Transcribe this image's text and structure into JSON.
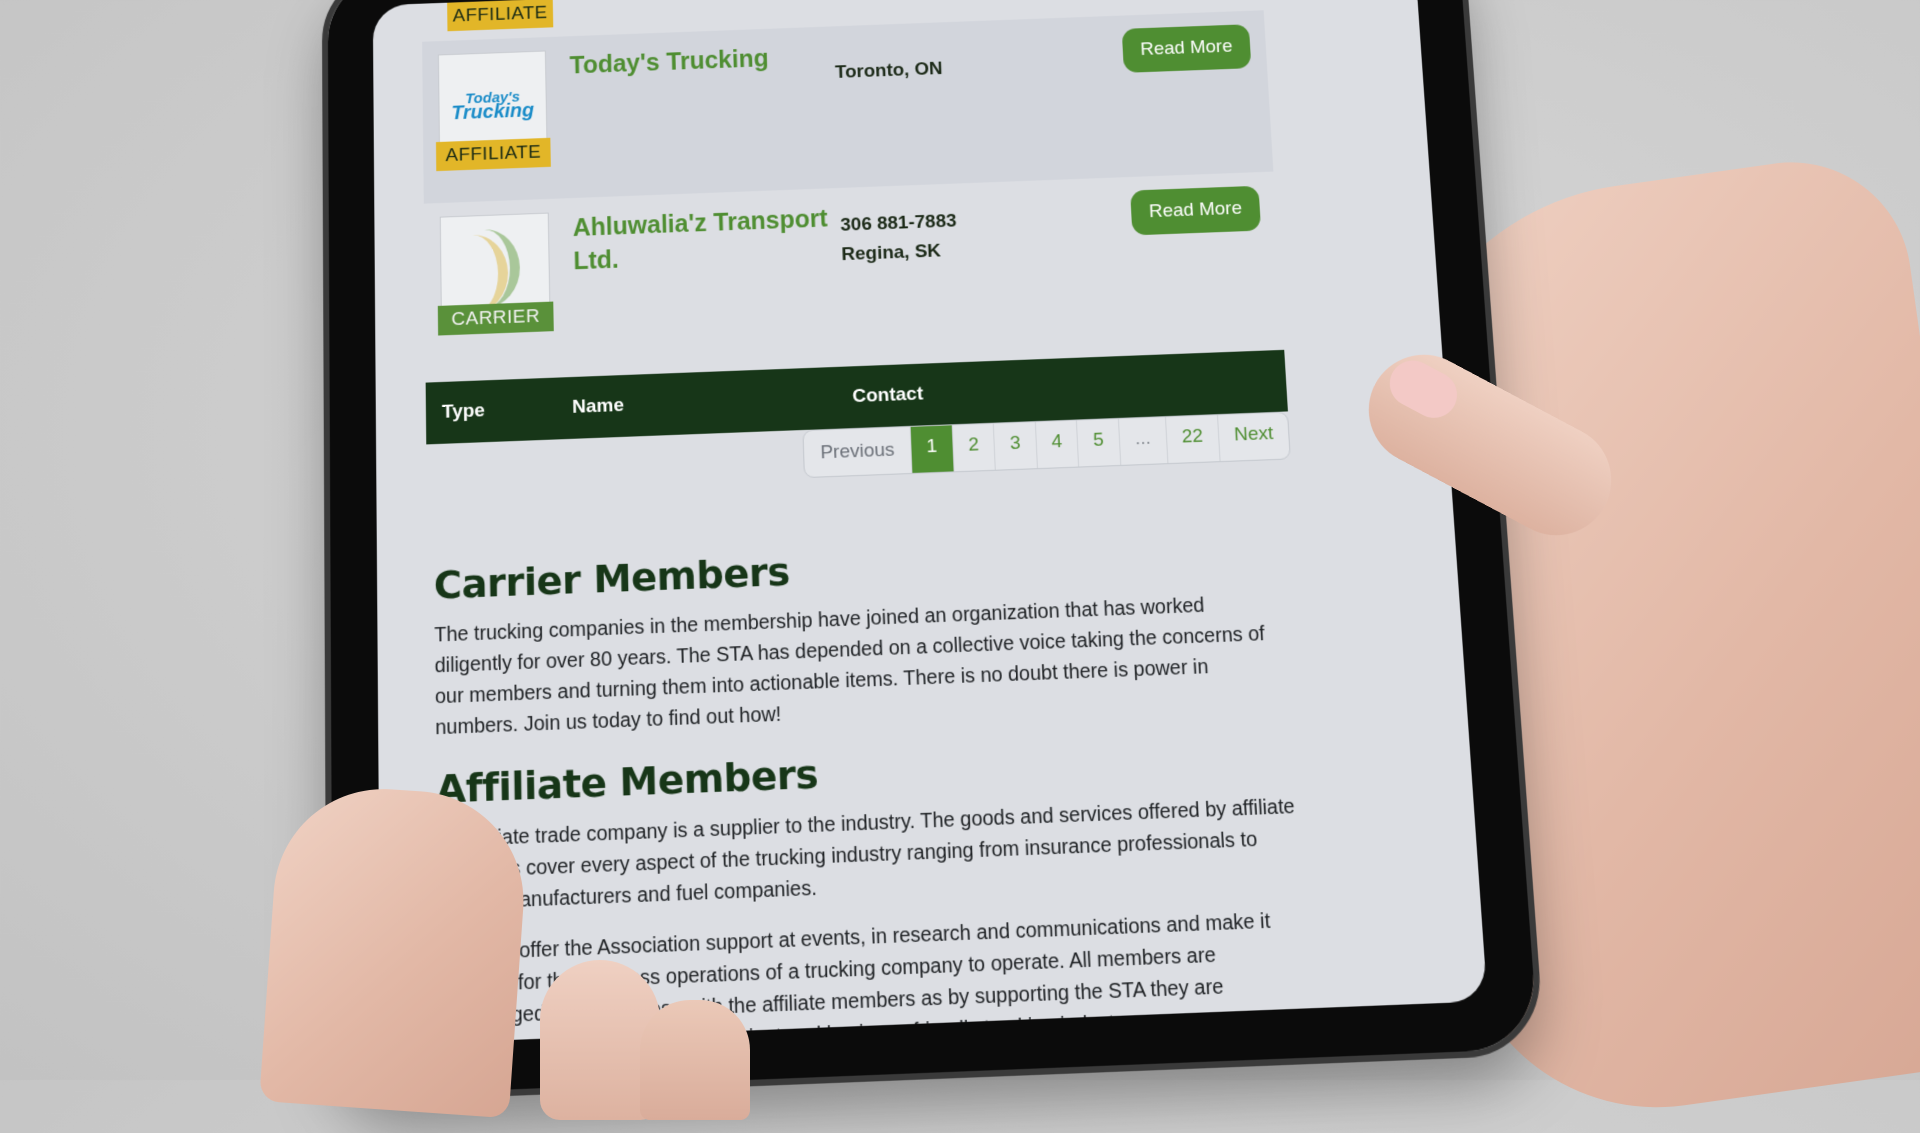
{
  "listings": [
    {
      "name": "Today's Trucking",
      "logo_text_top": "Today's",
      "logo_text_bottom": "Trucking",
      "type": "AFFILIATE",
      "phone": "",
      "location": "Toronto, ON",
      "button": "Read More"
    },
    {
      "name": "Ahluwalia'z Transport Ltd.",
      "type": "CARRIER",
      "phone": "306 881-7883",
      "location": "Regina, SK",
      "button": "Read More"
    }
  ],
  "previous_badge": "AFFILIATE",
  "table_header": {
    "type": "Type",
    "name": "Name",
    "contact": "Contact"
  },
  "pagination": {
    "previous": "Previous",
    "pages": [
      "1",
      "2",
      "3",
      "4",
      "5",
      "...",
      "22"
    ],
    "current": "1",
    "next": "Next"
  },
  "sections": {
    "carrier": {
      "title": "Carrier Members",
      "body": "The trucking companies in the membership have joined an organization that has worked diligently for over 80 years. The STA has depended on a collective voice taking the concerns of our members and turning them into actionable items. There is no doubt there is power in numbers. Join us today to find out how!"
    },
    "affiliate": {
      "title": "Affiliate Members",
      "body1": "An affiliate trade company is a supplier to the industry. The goods and services offered by affiliate members cover every aspect of the trucking industry ranging from insurance professionals to engine manufacturers and fuel companies.",
      "body2": "Affiliates offer the Association support at events, in research and communications and make it possible for the business operations of a trucking company to operate. All members are encouraged to do business with the affiliate members as by supporting the STA they are supporting the fostering of the efficient and business-friendly trucking industry."
    }
  },
  "colors": {
    "brand_green": "#4f8e32",
    "dark_green": "#173618",
    "affiliate_yellow": "#e2b628",
    "page_bg": "#dcdee3"
  }
}
